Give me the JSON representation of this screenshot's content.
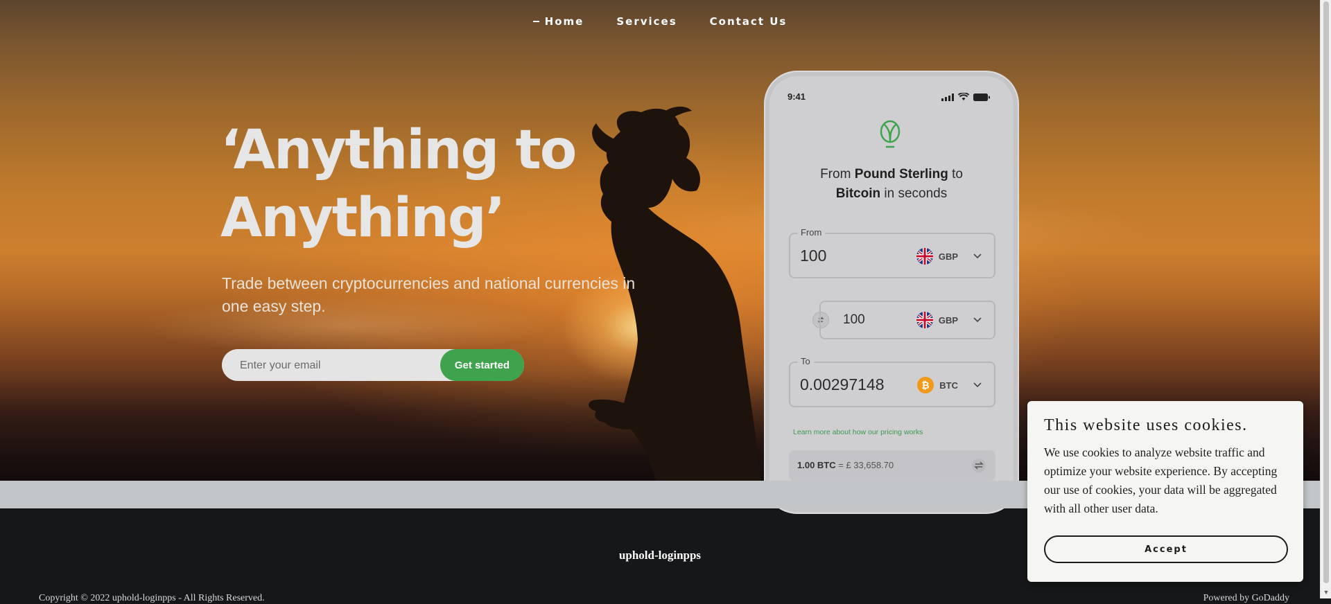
{
  "nav": {
    "items": [
      {
        "label": "Home",
        "active": true
      },
      {
        "label": "Services"
      },
      {
        "label": "Contact Us"
      }
    ]
  },
  "hero": {
    "headline": "‘Anything to Anything’",
    "subhead": "Trade between cryptocurrencies and national currencies in one easy step.",
    "email_placeholder": "Enter your email",
    "cta_label": "Get started"
  },
  "phone": {
    "time": "9:41",
    "title_prefix": "From ",
    "title_from": "Pound Sterling",
    "title_mid": " to ",
    "title_to": "Bitcoin",
    "title_suffix": " in seconds",
    "from": {
      "legend": "From",
      "amount": "100",
      "currency": "GBP",
      "flag": "uk-flag-icon"
    },
    "middle": {
      "amount": "100",
      "currency": "GBP",
      "flag": "uk-flag-icon"
    },
    "to": {
      "legend": "To",
      "amount": "0.00297148",
      "currency": "BTC",
      "icon": "bitcoin-icon"
    },
    "pricing_link": "Learn more about how our pricing works",
    "rate_left": "1.00 BTC",
    "rate_right": " = £ 33,658.70"
  },
  "footer": {
    "brand": "uphold-loginpps",
    "copyright": "Copyright © 2022 uphold-loginpps - All Rights Reserved.",
    "powered": "Powered by GoDaddy"
  },
  "cookie": {
    "title": "This website uses cookies.",
    "body": "We use cookies to analyze website traffic and optimize your website experience. By accepting our use of cookies, your data will be aggregated with all other user data.",
    "accept_label": "Accept"
  },
  "colors": {
    "accent_green": "#3fa34d",
    "footer_bg": "#161718",
    "band": "#c3c6c8"
  }
}
